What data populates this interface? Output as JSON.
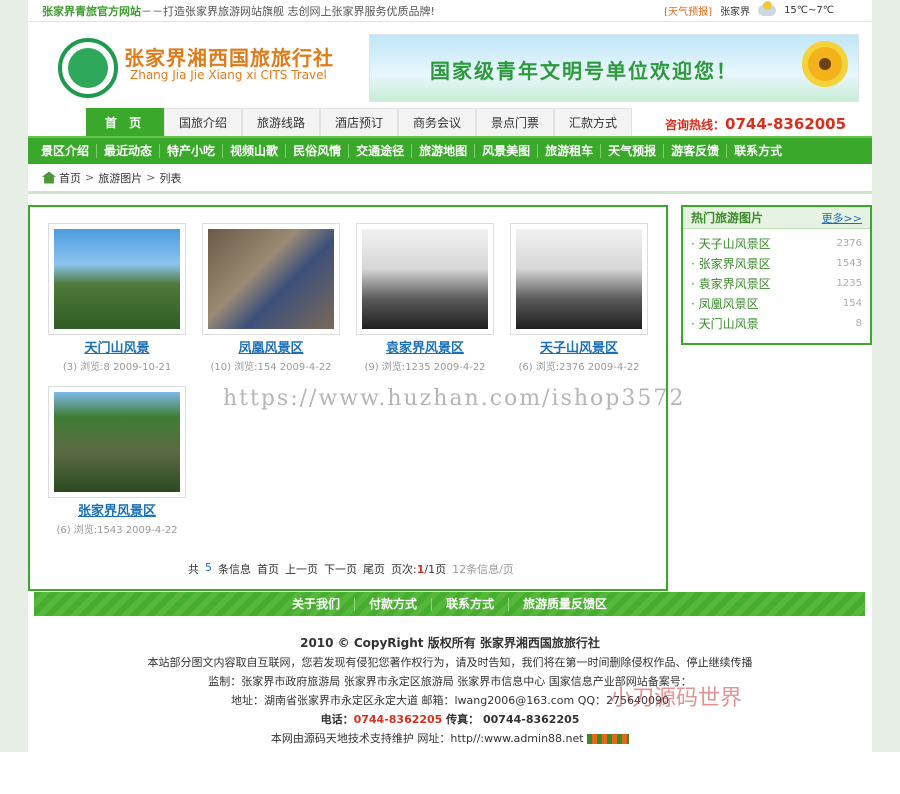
{
  "top": {
    "slogan": "张家界青旅官方网站",
    "slogan2": "－－打造张家界旅游网站旗舰  志创网上张家界服务优质品牌!",
    "weather_label": "[天气预报]",
    "city": "张家界",
    "temp": "15℃~7℃"
  },
  "brand": {
    "cn": "张家界湘西国旅旅行社",
    "en": "Zhang Jia Jie Xiang xi CITS Travel"
  },
  "banner": {
    "text": "国家级青年文明号单位欢迎您！"
  },
  "tabs": [
    "首 页",
    "国旅介绍",
    "旅游线路",
    "酒店预订",
    "商务会议",
    "景点门票",
    "汇款方式"
  ],
  "hotline": {
    "label": "咨询热线：",
    "number": "0744-8362005"
  },
  "subnav": [
    "景区介绍",
    "最近动态",
    "特产小吃",
    "视频山歌",
    "民俗风情",
    "交通途径",
    "旅游地图",
    "风景美图",
    "旅游租车",
    "天气预报",
    "游客反馈",
    "联系方式"
  ],
  "breadcrumb": [
    "首页",
    "旅游图片",
    "列表"
  ],
  "photos": [
    {
      "title": "天门山风景",
      "meta": "(3) 浏览:8  2009-10-21"
    },
    {
      "title": "凤凰风景区",
      "meta": "(10) 浏览:154  2009-4-22"
    },
    {
      "title": "袁家界风景区",
      "meta": "(9) 浏览:1235  2009-4-22"
    },
    {
      "title": "天子山风景区",
      "meta": "(6) 浏览:2376  2009-4-22"
    },
    {
      "title": "张家界风景区",
      "meta": "(6) 浏览:1543  2009-4-22"
    }
  ],
  "pager": {
    "total_label": "共",
    "total": "5",
    "unit": "条信息",
    "first": "首页",
    "prev": "上一页",
    "next": "下一页",
    "last": "尾页",
    "page_label": "页次:",
    "page": "1",
    "pages": "/1页",
    "per": "12条信息/页"
  },
  "sidebar": {
    "title": "热门旅游图片",
    "more": "更多>>",
    "items": [
      {
        "name": "· 天子山风景区",
        "count": "2376"
      },
      {
        "name": "· 张家界风景区",
        "count": "1543"
      },
      {
        "name": "· 袁家界风景区",
        "count": "1235"
      },
      {
        "name": "· 凤凰风景区",
        "count": "154"
      },
      {
        "name": "· 天门山风景",
        "count": "8"
      }
    ]
  },
  "footnav": [
    "关于我们",
    "付款方式",
    "联系方式",
    "旅游质量反馈区"
  ],
  "footer": {
    "copy": "2010 © CopyRight   版权所有  张家界湘西国旅旅行社",
    "notice": "本站部分图文内容取自互联网，您若发现有侵犯您著作权行为，请及时告知，我们将在第一时间删除侵权作品、停止继续传播",
    "supervise": "监制：张家界市政府旅游局   张家界市永定区旅游局   张家界市信息中心   国家信息产业部网站备案号：",
    "address": "地址：湖南省张家界市永定区永定大道  邮箱：lwang2006@163.com  QQ：275640090",
    "tel_label": "电话：",
    "tel": "0744-8362205",
    "fax": "  传真： 00744-8362205",
    "tech": "本网由源码天地技术支持维护      网址：http//:www.admin88.net"
  },
  "watermarks": [
    "https://www.huzhan.com/ishop3572",
    "小刀源码世界"
  ]
}
